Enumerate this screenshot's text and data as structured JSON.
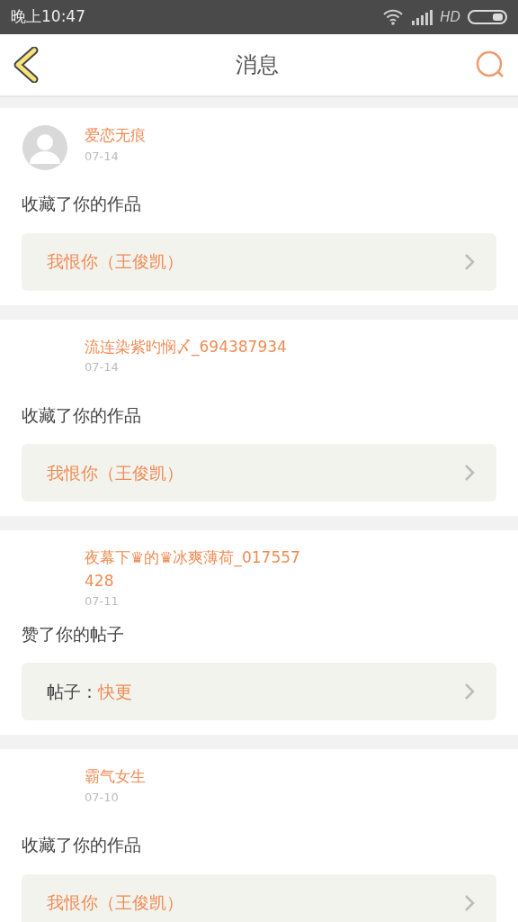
{
  "status_bar": {
    "time": "晚上10:47",
    "network": "HD"
  },
  "header": {
    "title": "消息"
  },
  "messages": [
    {
      "user": "爱恋无痕",
      "has_avatar": true,
      "date": "07-14",
      "action": "收藏了你的作品",
      "target": {
        "kind": "work",
        "title": "我恨你（王俊凯）"
      }
    },
    {
      "user": "流连染紫旳悯〆_694387934",
      "has_avatar": false,
      "date": "07-14",
      "action": "收藏了你的作品",
      "target": {
        "kind": "work",
        "title": "我恨你（王俊凯）"
      }
    },
    {
      "user": "夜幕下♛的♛冰爽薄荷_017557428",
      "has_avatar": false,
      "date": "07-11",
      "action": "赞了你的帖子",
      "target": {
        "kind": "post",
        "label": "帖子：",
        "title": "快更"
      }
    },
    {
      "user": "霸气女生",
      "has_avatar": false,
      "date": "07-10",
      "action": "收藏了你的作品",
      "target": {
        "kind": "work",
        "title": "我恨你（王俊凯）"
      }
    }
  ]
}
